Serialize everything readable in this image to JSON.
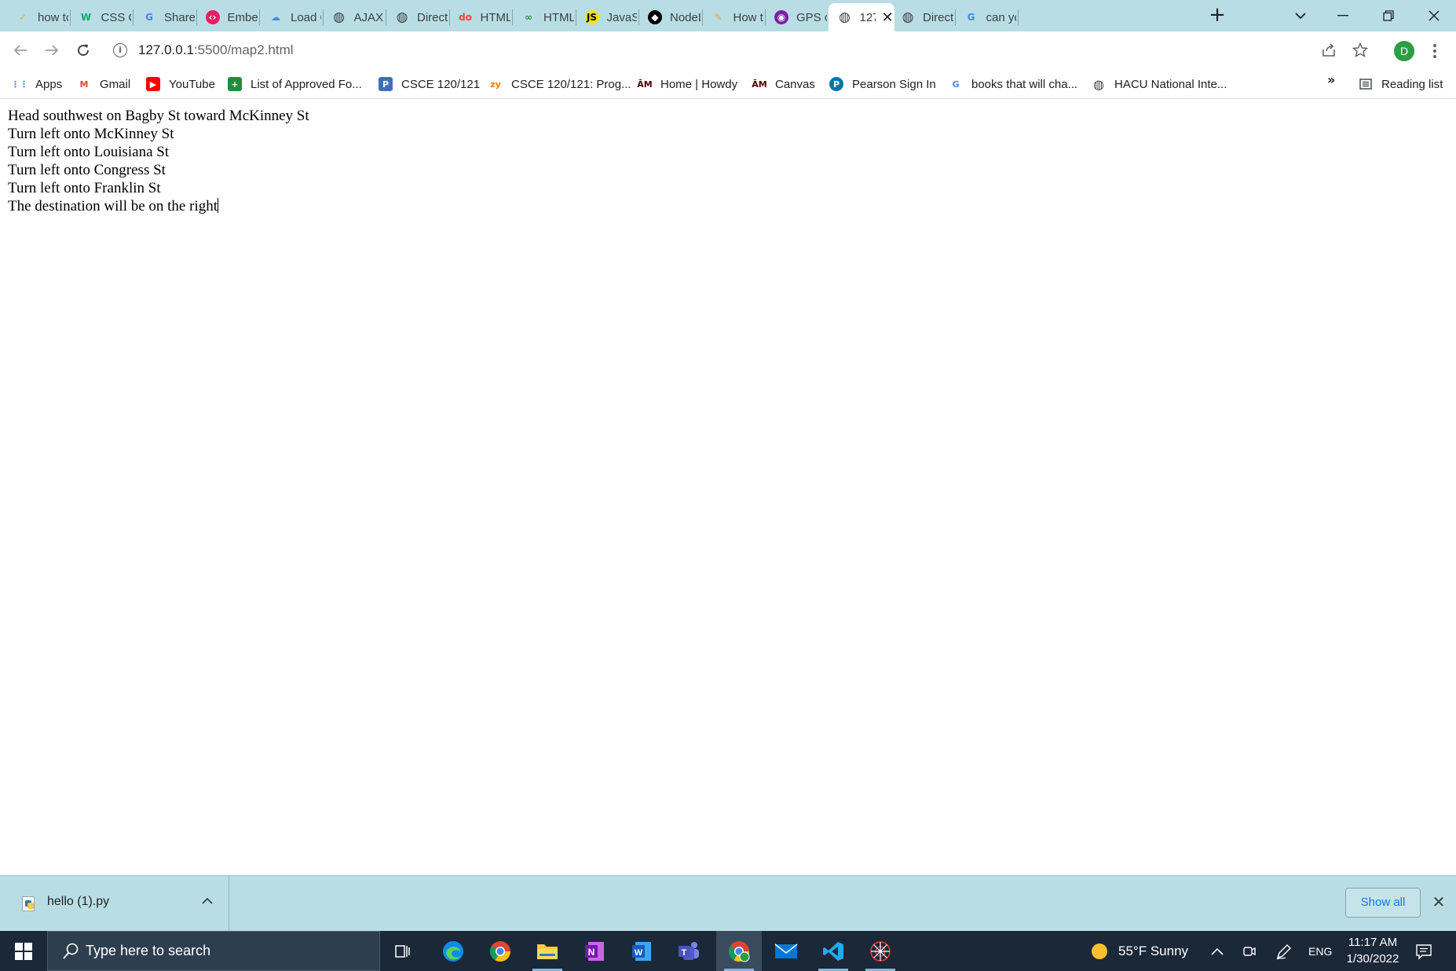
{
  "browser": {
    "tabs": [
      {
        "title": "how to",
        "favicon": "kite-icon",
        "color": "#f4b400"
      },
      {
        "title": "CSS Ov",
        "favicon": "w3schools-icon",
        "color": "#04aa6d"
      },
      {
        "title": "Share",
        "favicon": "google-icon",
        "color": "#4285f4"
      },
      {
        "title": "Embed",
        "favicon": "code-icon",
        "color": "#e91e63"
      },
      {
        "title": "Load G",
        "favicon": "cloud-icon",
        "color": "#4285f4"
      },
      {
        "title": "AJAX",
        "favicon": "globe-icon",
        "color": "#3c4043"
      },
      {
        "title": "Directi",
        "favicon": "globe-icon",
        "color": "#3c4043"
      },
      {
        "title": "HTML",
        "favicon": "do-icon",
        "color": "#e8453c"
      },
      {
        "title": "HTML",
        "favicon": "geeks-icon",
        "color": "#2f8d46"
      },
      {
        "title": "JavaSc",
        "favicon": "js-icon",
        "color": "#f7df1e"
      },
      {
        "title": "NodeL",
        "favicon": "node-icon",
        "color": "#000000"
      },
      {
        "title": "How to",
        "favicon": "pen-icon",
        "color": "#e6a23c"
      },
      {
        "title": "GPS co",
        "favicon": "gps-icon",
        "color": "#7b1fa2"
      },
      {
        "title": "127",
        "favicon": "globe-icon",
        "color": "#3c4043",
        "active": true
      },
      {
        "title": "Directi",
        "favicon": "globe-icon",
        "color": "#3c4043"
      },
      {
        "title": "can yo",
        "favicon": "google-icon",
        "color": "#4285f4"
      }
    ],
    "new_tab_label": "+",
    "address": {
      "host": "127.0.0.1",
      "path": ":5500/map2.html"
    },
    "profile_initial": "D",
    "bookmarks": [
      {
        "label": "Apps",
        "icon": "apps-grid-icon"
      },
      {
        "label": "Gmail",
        "icon": "gmail-icon"
      },
      {
        "label": "YouTube",
        "icon": "youtube-icon"
      },
      {
        "label": "List of Approved Fo...",
        "icon": "green-plus-icon"
      },
      {
        "label": "CSCE 120/121",
        "icon": "p-icon"
      },
      {
        "label": "CSCE 120/121: Prog...",
        "icon": "zy-icon"
      },
      {
        "label": "Home | Howdy",
        "icon": "atm-icon"
      },
      {
        "label": "Canvas",
        "icon": "atm-icon"
      },
      {
        "label": "Pearson Sign In",
        "icon": "pearson-icon"
      },
      {
        "label": "books that will cha...",
        "icon": "google-icon"
      },
      {
        "label": "HACU National Inte...",
        "icon": "globe-icon"
      }
    ],
    "bookmarks_overflow": "»",
    "reading_list": "Reading list"
  },
  "page": {
    "lines": [
      "Head southwest on Bagby St toward McKinney St",
      "Turn left onto McKinney St",
      "Turn left onto Louisiana St",
      "Turn left onto Congress St",
      "Turn left onto Franklin St",
      "The destination will be on the right"
    ]
  },
  "downloads": {
    "file_name": "hello (1).py",
    "show_all": "Show all"
  },
  "taskbar": {
    "search_placeholder": "Type here to search",
    "weather": "55°F  Sunny",
    "language": "ENG",
    "time": "11:17 AM",
    "date": "1/30/2022"
  }
}
